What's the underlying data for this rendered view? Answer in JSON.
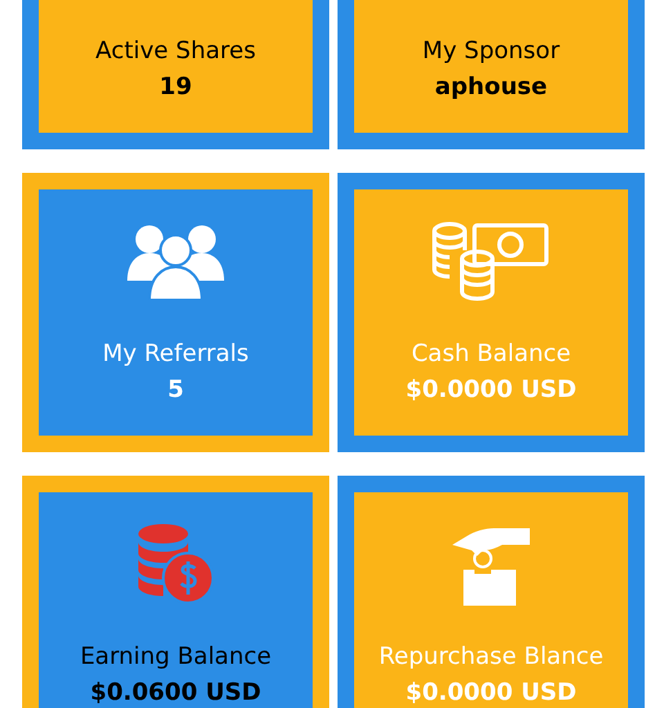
{
  "cards": [
    {
      "title": "Active Shares",
      "value": "19"
    },
    {
      "title": "My Sponsor",
      "value": "aphouse"
    },
    {
      "title": "My Referrals",
      "value": "5"
    },
    {
      "title": "Cash Balance",
      "value": "$0.0000 USD"
    },
    {
      "title": "Earning Balance",
      "value": "$0.0600 USD"
    },
    {
      "title": "Repurchase Blance",
      "value": "$0.0000 USD"
    }
  ]
}
